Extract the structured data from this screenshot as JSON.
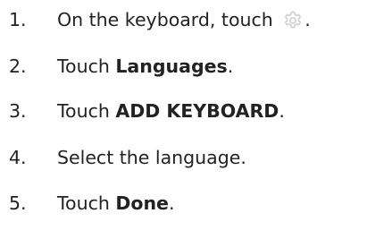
{
  "steps": [
    {
      "number": "1.",
      "prefix": "On the keyboard, touch ",
      "icon": "gear-icon",
      "suffix": "."
    },
    {
      "number": "2.",
      "prefix": "Touch ",
      "bold": "Languages",
      "suffix": "."
    },
    {
      "number": "3.",
      "prefix": "Touch ",
      "bold": "ADD KEYBOARD",
      "suffix": "."
    },
    {
      "number": "4.",
      "text": "Select the language."
    },
    {
      "number": "5.",
      "prefix": "Touch ",
      "bold": "Done",
      "suffix": "."
    }
  ],
  "icon_color": "#cfcfcf"
}
